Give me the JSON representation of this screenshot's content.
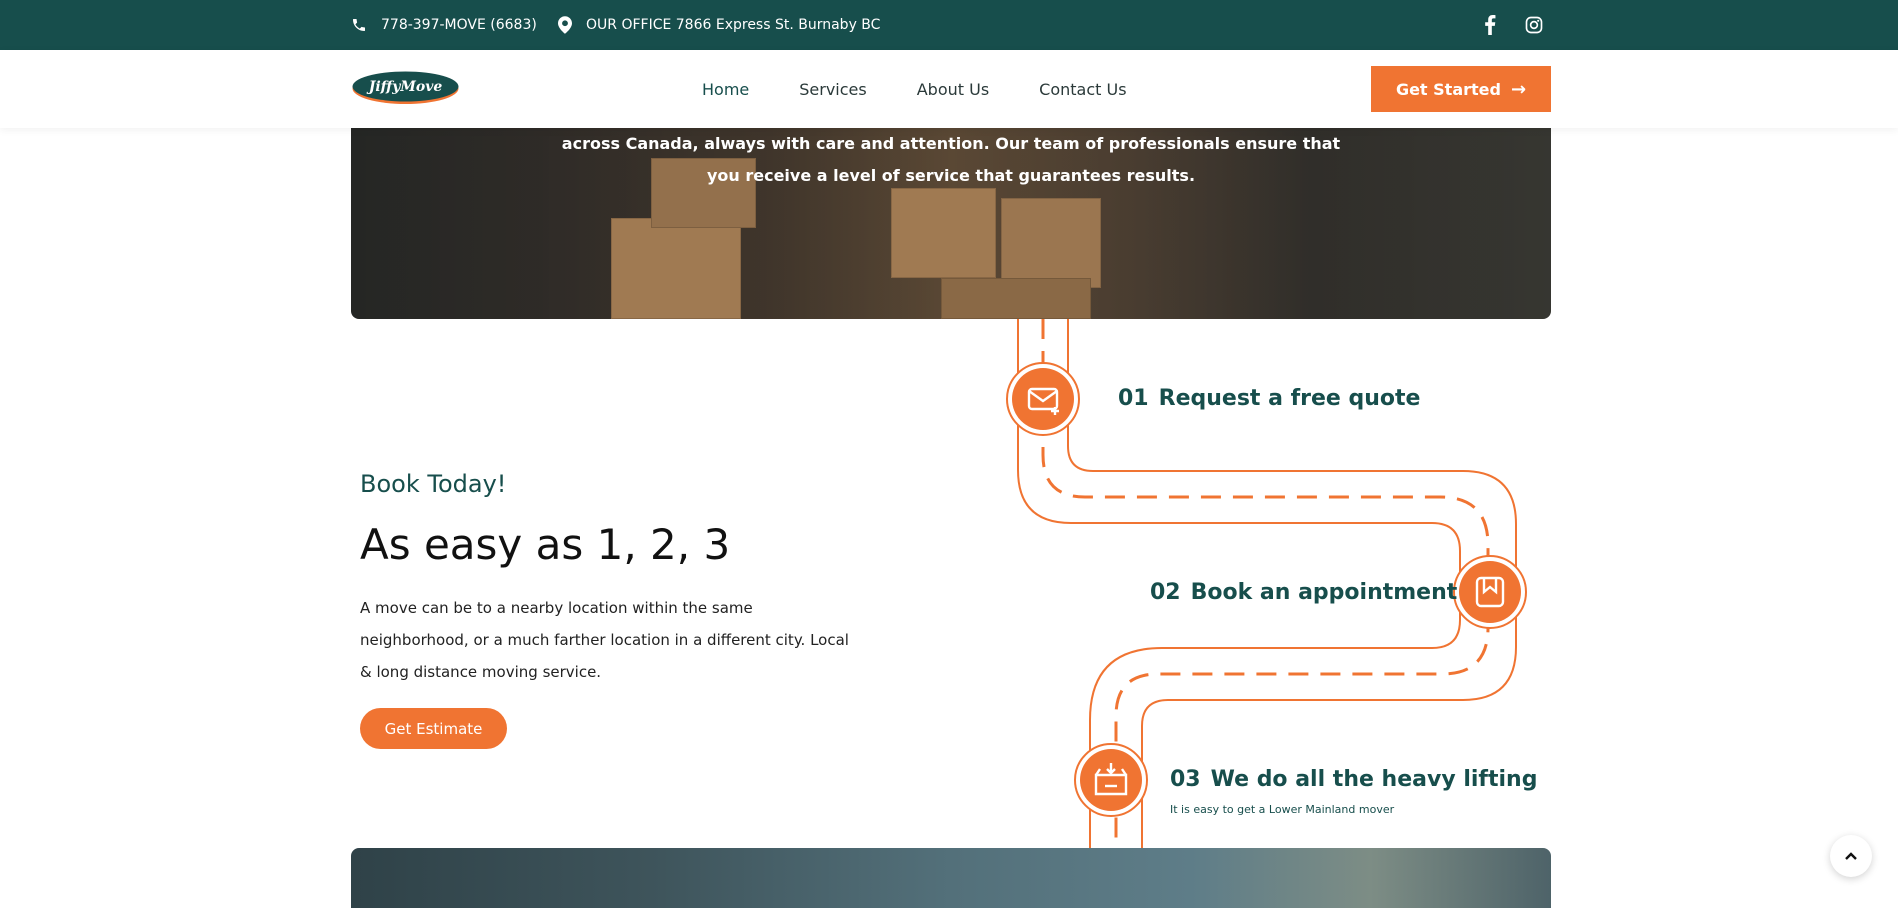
{
  "topbar": {
    "phone": "778-397-MOVE (6683)",
    "office": "OUR OFFICE 7866 Express St. Burnaby BC",
    "icons": [
      "phone-icon",
      "map-pin-icon",
      "facebook-icon",
      "instagram-icon"
    ]
  },
  "nav": {
    "logo_text": "JiffyMove",
    "links": [
      "Home",
      "Services",
      "About Us",
      "Contact Us"
    ],
    "active": "Home",
    "cta": "Get Started"
  },
  "hero": {
    "line1": "across Canada, always with care and attention. Our team of professionals ensure that",
    "line2": "you receive a level of service that guarantees results."
  },
  "book": {
    "kicker": "Book Today!",
    "title": "As easy as 1, 2, 3",
    "description": "A move can be to a nearby location within the same neighborhood, or a much farther location in a different city. Local & long distance moving service.",
    "button": "Get Estimate"
  },
  "steps": [
    {
      "num": "01",
      "title": "Request a free quote",
      "icon": "envelope-plus-icon"
    },
    {
      "num": "02",
      "title": "Book an appointment",
      "icon": "bookmark-icon"
    },
    {
      "num": "03",
      "title": "We do all the heavy lifting",
      "subtitle": "It is easy to get a Lower Mainland mover",
      "icon": "box-download-icon"
    }
  ],
  "colors": {
    "brand_dark": "#174e4c",
    "accent": "#f07432"
  }
}
